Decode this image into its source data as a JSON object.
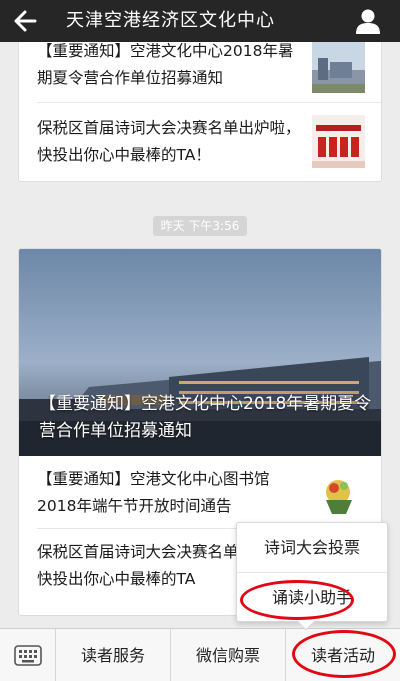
{
  "header": {
    "title": "天津空港经济区文化中心",
    "back_icon": "back-arrow-icon",
    "profile_icon": "person-icon"
  },
  "message1": {
    "items": [
      {
        "title": "【重要通知】空港文化中心2018年暑期夏令营合作单位招募通知",
        "thumb": "building-thumbnail"
      },
      {
        "title": "保税区首届诗词大会决赛名单出炉啦，快投出你心中最棒的TA！",
        "thumb": "poetry-contest-thumbnail"
      }
    ]
  },
  "timestamp": "昨天 下午3:56",
  "message2": {
    "cover_title": "【重要通知】空港文化中心2018年暑期夏令营合作单位招募通知",
    "items": [
      {
        "title": "【重要通知】空港文化中心图书馆2018年端午节开放时间通告",
        "thumb": "dragon-boat-thumbnail"
      },
      {
        "title": "保税区首届诗词大会决赛名单出炉啦，快投出你心中最棒的TA"
      }
    ]
  },
  "popup_menu": {
    "items": [
      "诗词大会投票",
      "诵读小助手"
    ]
  },
  "bottom_bar": {
    "keyboard_icon": "keyboard-icon",
    "menus": [
      "读者服务",
      "微信购票",
      "读者活动"
    ]
  },
  "colors": {
    "header_bg": "#262626",
    "highlight_ring": "#e30613"
  }
}
